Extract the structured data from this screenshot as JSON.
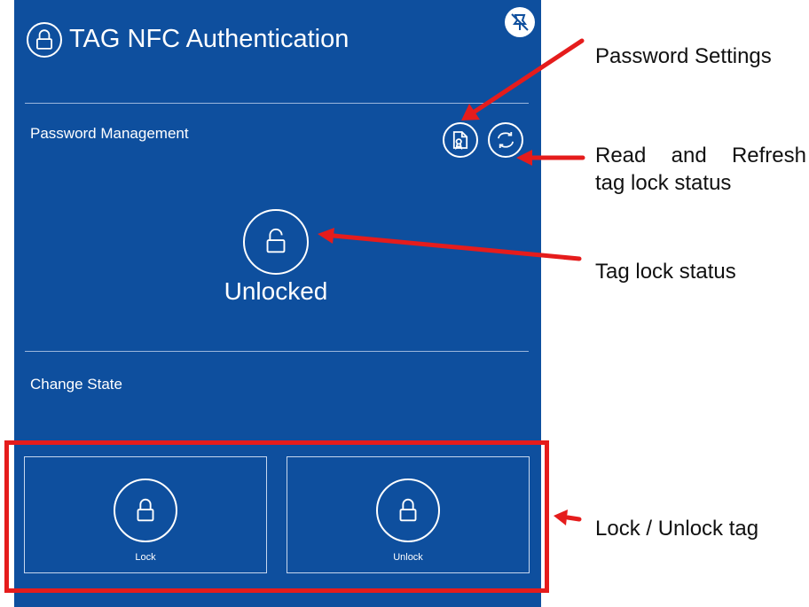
{
  "app": {
    "title": "TAG NFC Authentication"
  },
  "password_section": {
    "label": "Password Management"
  },
  "lock_status": {
    "text": "Unlocked"
  },
  "change_section": {
    "label": "Change State",
    "buttons": [
      {
        "label": "Lock"
      },
      {
        "label": "Unlock"
      }
    ]
  },
  "annotations": {
    "password_settings": "Password Settings",
    "read_refresh_line1": "Read and Refresh",
    "read_refresh_line2": "tag lock status",
    "tag_lock_status": "Tag lock status",
    "lock_unlock_tag": "Lock / Unlock tag"
  },
  "colors": {
    "panel_bg": "#0e4f9e",
    "annotation_red": "#e51c1c",
    "text_white": "#ffffff"
  },
  "icons": {
    "title": "lock-icon",
    "pin": "pin-off-icon",
    "password_settings": "password-file-icon",
    "refresh": "refresh-icon",
    "status": "open-lock-icon",
    "lock": "lock-icon",
    "unlock": "lock-icon"
  }
}
